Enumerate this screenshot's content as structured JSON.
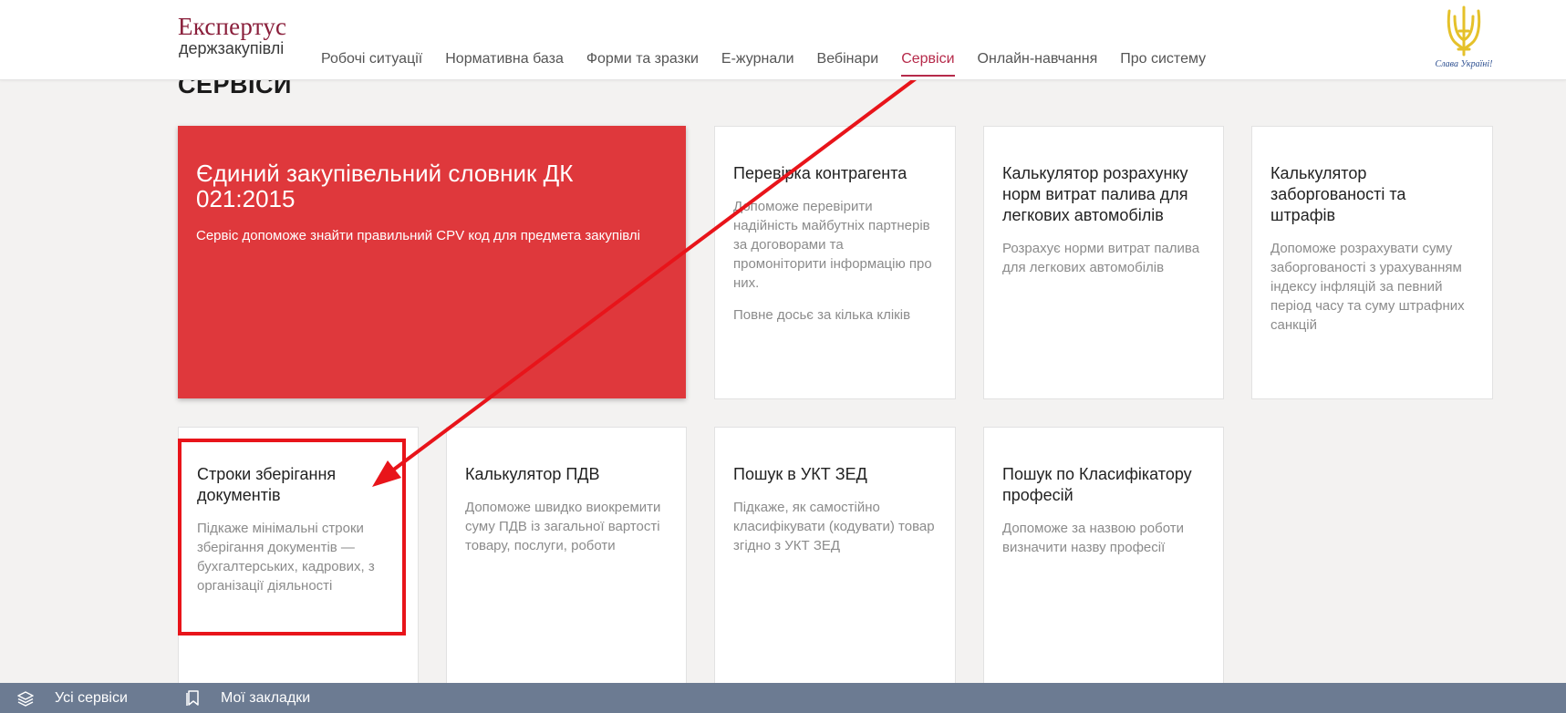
{
  "header": {
    "logo_main": "Експертус",
    "logo_sub": "держзакупівлі",
    "emblem_text": "Слава Україні!",
    "nav": [
      {
        "label": "Робочі ситуації",
        "active": false
      },
      {
        "label": "Нормативна база",
        "active": false
      },
      {
        "label": "Форми та зразки",
        "active": false
      },
      {
        "label": "Е-журнали",
        "active": false
      },
      {
        "label": "Вебінари",
        "active": false
      },
      {
        "label": "Сервіси",
        "active": true
      },
      {
        "label": "Онлайн-навчання",
        "active": false
      },
      {
        "label": "Про систему",
        "active": false
      }
    ]
  },
  "page": {
    "title": "СЕРВІСИ"
  },
  "cards": {
    "featured": {
      "title": "Єдиний закупівельний словник ДК 021:2015",
      "desc": "Сервіс допоможе знайти правильний CPV код для предмета закупівлі"
    },
    "counterparty": {
      "title": "Перевірка контрагента",
      "desc": "Допоможе перевірити надійність майбутніх партнерів за договорами та промоніторити інформацію про них.",
      "extra": "Повне досьє за кілька кліків"
    },
    "fuel": {
      "title": "Калькулятор розрахунку норм витрат палива для легкових автомобілів",
      "desc": "Розрахує норми витрат палива для легкових автомобілів"
    },
    "debt": {
      "title": "Калькулятор заборгованості та штрафів",
      "desc": "Допоможе розрахувати суму заборгованості з урахуванням індексу інфляцій за певний період часу та суму штрафних санкцій"
    },
    "storage": {
      "title": "Строки зберігання документів",
      "desc": "Підкаже мінімальні строки зберігання документів — бухгалтерських, кадрових, з організації діяльності"
    },
    "vat": {
      "title": "Калькулятор ПДВ",
      "desc": "Допоможе швидко виокремити суму ПДВ із загальної вартості товару, послуги, роботи"
    },
    "uktzed": {
      "title": "Пошук в УКТ ЗЕД",
      "desc": "Підкаже, як самостійно класифікувати (кодувати) товар згідно з УКТ ЗЕД"
    },
    "professions": {
      "title": "Пошук по Класифікатору професій",
      "desc": "Допоможе за назвою роботи визначити назву професії"
    }
  },
  "bottom_bar": {
    "all_services": "Усі сервіси",
    "bookmarks": "Мої закладки"
  },
  "colors": {
    "brand": "#8a1f3b",
    "accent": "#b62a4a",
    "featured_card": "#df383c",
    "annotation": "#e8141a",
    "bottom_bar": "#6c7b92"
  },
  "icons": {
    "emblem": "trident-icon",
    "all_services": "layers-icon",
    "bookmarks": "bookmark-icon"
  }
}
